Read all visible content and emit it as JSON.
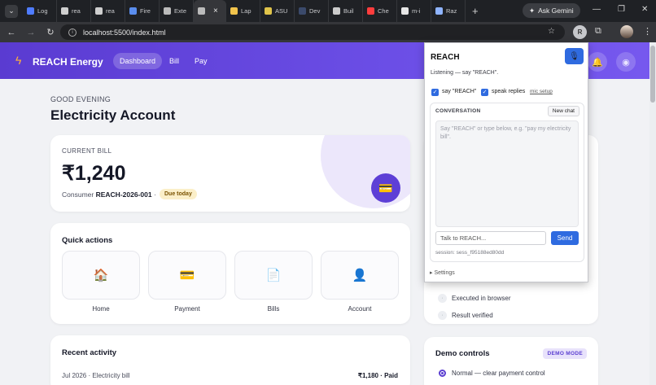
{
  "browser": {
    "tabs": [
      {
        "title": "Log",
        "fav": "#4f7cff"
      },
      {
        "title": "rea",
        "fav": "#cfcfcf"
      },
      {
        "title": "rea",
        "fav": "#cfcfcf"
      },
      {
        "title": "Fire",
        "fav": "#5a8dee"
      },
      {
        "title": "Exte",
        "fav": "#bbbbbb"
      },
      {
        "title": "",
        "fav": "#bbbbbb"
      },
      {
        "title": "Lap",
        "fav": "#f2c44c"
      },
      {
        "title": "ASU",
        "fav": "#e0c44a"
      },
      {
        "title": "Dev",
        "fav": "#3b4a6b"
      },
      {
        "title": "Buil",
        "fav": "#cccccc"
      },
      {
        "title": "Che",
        "fav": "#ff3d3d"
      },
      {
        "title": "m-i",
        "fav": "#e6e6e6"
      },
      {
        "title": "Raz",
        "fav": "#8fb4ff"
      }
    ],
    "active_tab_close": "×",
    "new_tab": "+",
    "gemini": "Ask Gemini",
    "url": "localhost:5500/index.html",
    "ext_initial": "R"
  },
  "header": {
    "brand": "REACH Energy",
    "nav": [
      "Dashboard",
      "Bill",
      "Pay"
    ]
  },
  "main": {
    "greeting": "GOOD EVENING",
    "title": "Electricity Account",
    "bill": {
      "label": "CURRENT BILL",
      "amount": "₹1,240",
      "consumer_prefix": "Consumer",
      "consumer_id": "REACH-2026-001",
      "due_badge": "Due today"
    },
    "quick_actions": {
      "title": "Quick actions",
      "items": [
        {
          "label": "Home",
          "icon": "🏠"
        },
        {
          "label": "Payment",
          "icon": "💳"
        },
        {
          "label": "Bills",
          "icon": "📄"
        },
        {
          "label": "Account",
          "icon": "👤"
        }
      ]
    },
    "activity": {
      "title": "Recent activity",
      "rows": [
        {
          "desc": "Jul 2026 · Electricity bill",
          "amount": "₹1,180 · Paid"
        }
      ]
    },
    "steps": [
      "Executed in browser",
      "Result verified"
    ],
    "demo": {
      "title": "Demo controls",
      "badge": "DEMO MODE",
      "option": "Normal — clear payment control"
    }
  },
  "popup": {
    "title": "REACH",
    "status": "Listening — say \"REACH\".",
    "checkbox1": "say \"REACH\"",
    "checkbox2": "speak replies",
    "mic_setup": "mic setup",
    "conversation_label": "CONVERSATION",
    "new_chat": "New chat",
    "placeholder": "Say \"REACH\" or type below, e.g. \"pay my electricity bill\".",
    "input_placeholder": "Talk to REACH...",
    "send": "Send",
    "session": "session: sess_f95188ed80dd",
    "settings": "▸ Settings"
  }
}
